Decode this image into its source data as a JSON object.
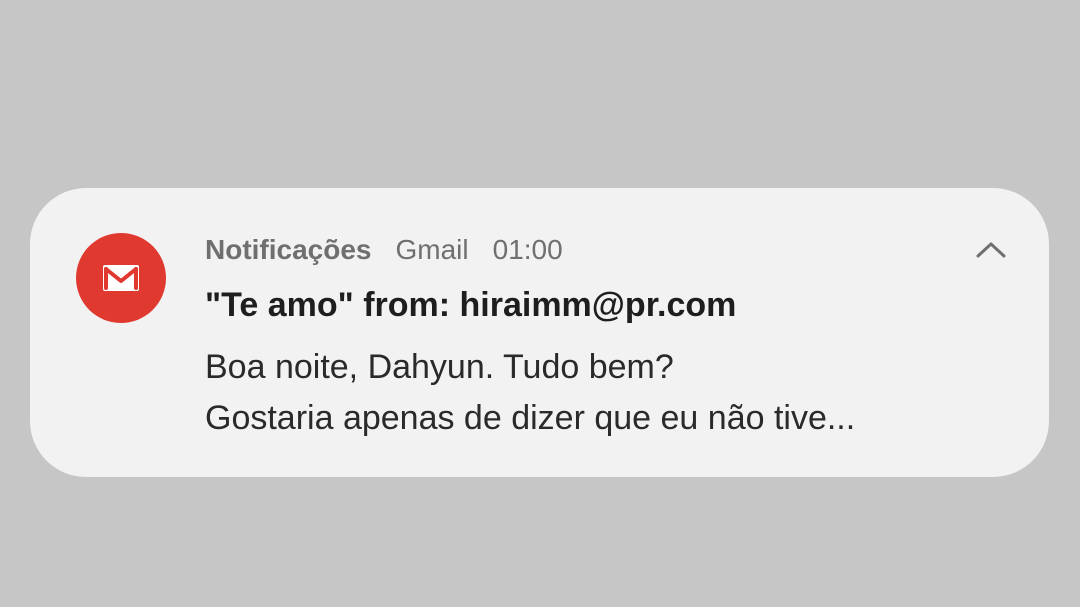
{
  "notification": {
    "app_name": "Notificações",
    "source": "Gmail",
    "time": "01:00",
    "title": "\"Te amo\" from: hiraimm@pr.com",
    "body_lines": [
      "Boa noite, Dahyun. Tudo bem?",
      "Gostaria apenas de dizer que eu não tive..."
    ],
    "icon": "gmail-icon",
    "collapse_icon": "chevron-up-icon",
    "colors": {
      "background": "#c6c6c6",
      "card": "#f2f2f2",
      "icon_bg": "#e03a30",
      "title": "#1e1e1e",
      "meta": "#6f6f6f"
    }
  }
}
